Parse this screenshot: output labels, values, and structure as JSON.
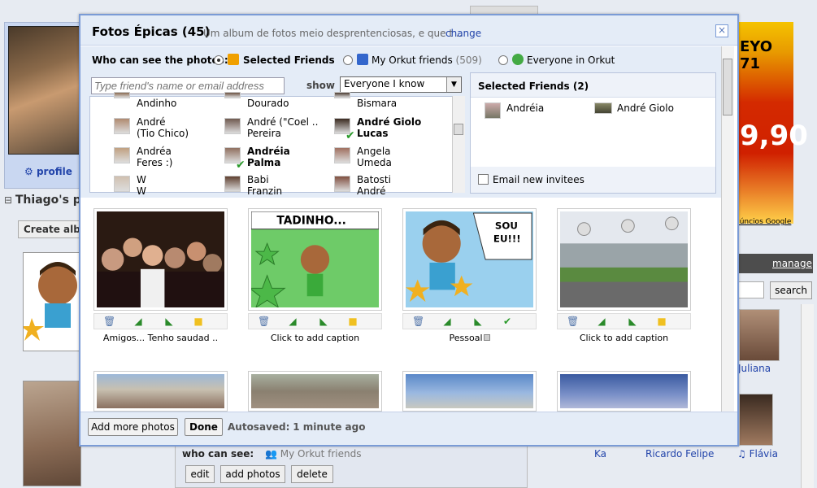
{
  "background": {
    "profile_link": "profile",
    "section_title": "Thiago's p",
    "create_album": "Create albu",
    "ad_note": "núncios Google",
    "manage": "manage",
    "search_button": "search",
    "friend_juliana": "Juliana",
    "bottom_friends": [
      "Ka",
      "Ricardo Felipe",
      "Flávia"
    ],
    "who_can_see_label": "who can see:",
    "who_can_see_value": "My Orkut friends",
    "buttons": [
      "edit",
      "add photos",
      "delete"
    ]
  },
  "dialog": {
    "title": "Fotos Épicas (45)",
    "description": "Um album de fotos meio desprentenciosas, e que t ..",
    "change_link": "change",
    "close_icon": "×",
    "privacy": {
      "label": "Who can see the photos:",
      "options": [
        {
          "label": "Selected Friends",
          "selected": true,
          "bold": true,
          "count": ""
        },
        {
          "label": "My Orkut friends",
          "selected": false,
          "bold": false,
          "count": "(509)"
        },
        {
          "label": "Everyone in Orkut",
          "selected": false,
          "bold": false,
          "count": ""
        }
      ]
    },
    "friend_search_placeholder": "Type friend's name or email address",
    "show_label": "show",
    "show_value": "Everyone I know",
    "friends": [
      {
        "line1": "Andinho",
        "line2": "",
        "checked": false
      },
      {
        "line1": "Dourado",
        "line2": "",
        "checked": false
      },
      {
        "line1": "Bismara",
        "line2": "",
        "checked": false
      },
      {
        "line1": "André",
        "line2": "(Tio Chico)",
        "checked": false
      },
      {
        "line1": "André (\"Coel ..",
        "line2": "Pereira",
        "checked": false
      },
      {
        "line1": "André Giolo",
        "line2": "Lucas",
        "checked": true
      },
      {
        "line1": "Andréa",
        "line2": "Feres :)",
        "checked": false
      },
      {
        "line1": "Andréia",
        "line2": "Palma",
        "checked": true
      },
      {
        "line1": "Angela",
        "line2": "Umeda",
        "checked": false
      },
      {
        "line1": "W",
        "line2": "W",
        "checked": false
      },
      {
        "line1": "Babi",
        "line2": "Franzin",
        "checked": false
      },
      {
        "line1": "Batosti",
        "line2": "André",
        "checked": false
      }
    ],
    "selected_title": "Selected Friends (2)",
    "selected_friends": [
      "Andréia",
      "André Giolo"
    ],
    "email_invitees": "Email new invitees",
    "photos": [
      {
        "caption": "Amigos... Tenho saudad ..",
        "image": "group-photo"
      },
      {
        "caption": "Click to add caption",
        "image": "cartoon-tadinho",
        "overlay": "TADINHO..."
      },
      {
        "caption": "Pessoal",
        "image": "cartoon-sou-eu",
        "overlay": "SOU EU!!!"
      },
      {
        "caption": "Click to add caption",
        "image": "building-balloons"
      }
    ],
    "add_more_photos": "Add more photos",
    "done": "Done",
    "autosaved_label": "Autosaved:",
    "autosaved_value": "1 minute ago"
  },
  "colors": {
    "dialog_border": "#7a9bd6",
    "header_bg": "#e4ecf7",
    "link": "#2244aa"
  }
}
